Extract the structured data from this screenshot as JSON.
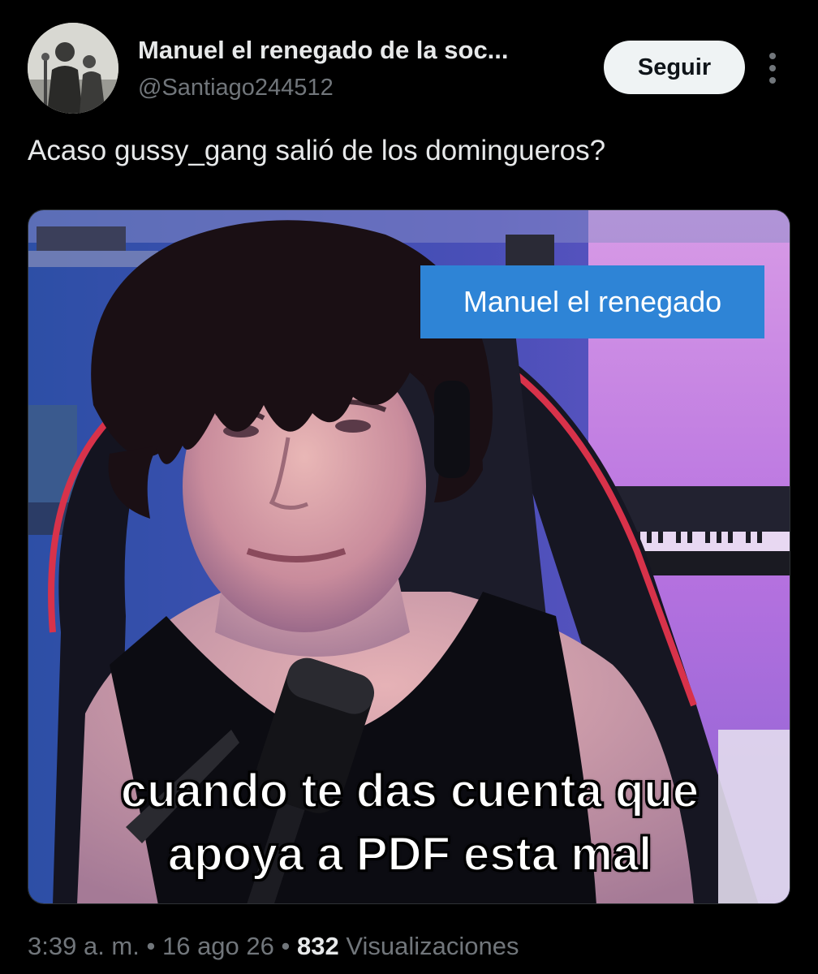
{
  "author": {
    "name": "Manuel el renegado de la soc...",
    "handle": "@Santiago244512",
    "avatar_icon": "avatar-photo"
  },
  "actions": {
    "follow_label": "Seguir",
    "more_icon": "more-vertical-icon"
  },
  "tweet": {
    "text": "Acaso gussy_gang salió de los domingueros?"
  },
  "media": {
    "label_box": "Manuel el renegado",
    "caption_line1": "cuando te das cuenta que",
    "caption_line2": "apoya a PDF esta mal",
    "label_color": "#2e84d6"
  },
  "meta": {
    "time": "3:39 a. m.",
    "separator": "•",
    "date": "16 ago 26",
    "views_count": "832",
    "views_label": "Visualizaciones"
  },
  "colors": {
    "background": "#000000",
    "primary_text": "#e7e9ea",
    "secondary_text": "#71767b",
    "button_bg": "#eff3f4"
  }
}
